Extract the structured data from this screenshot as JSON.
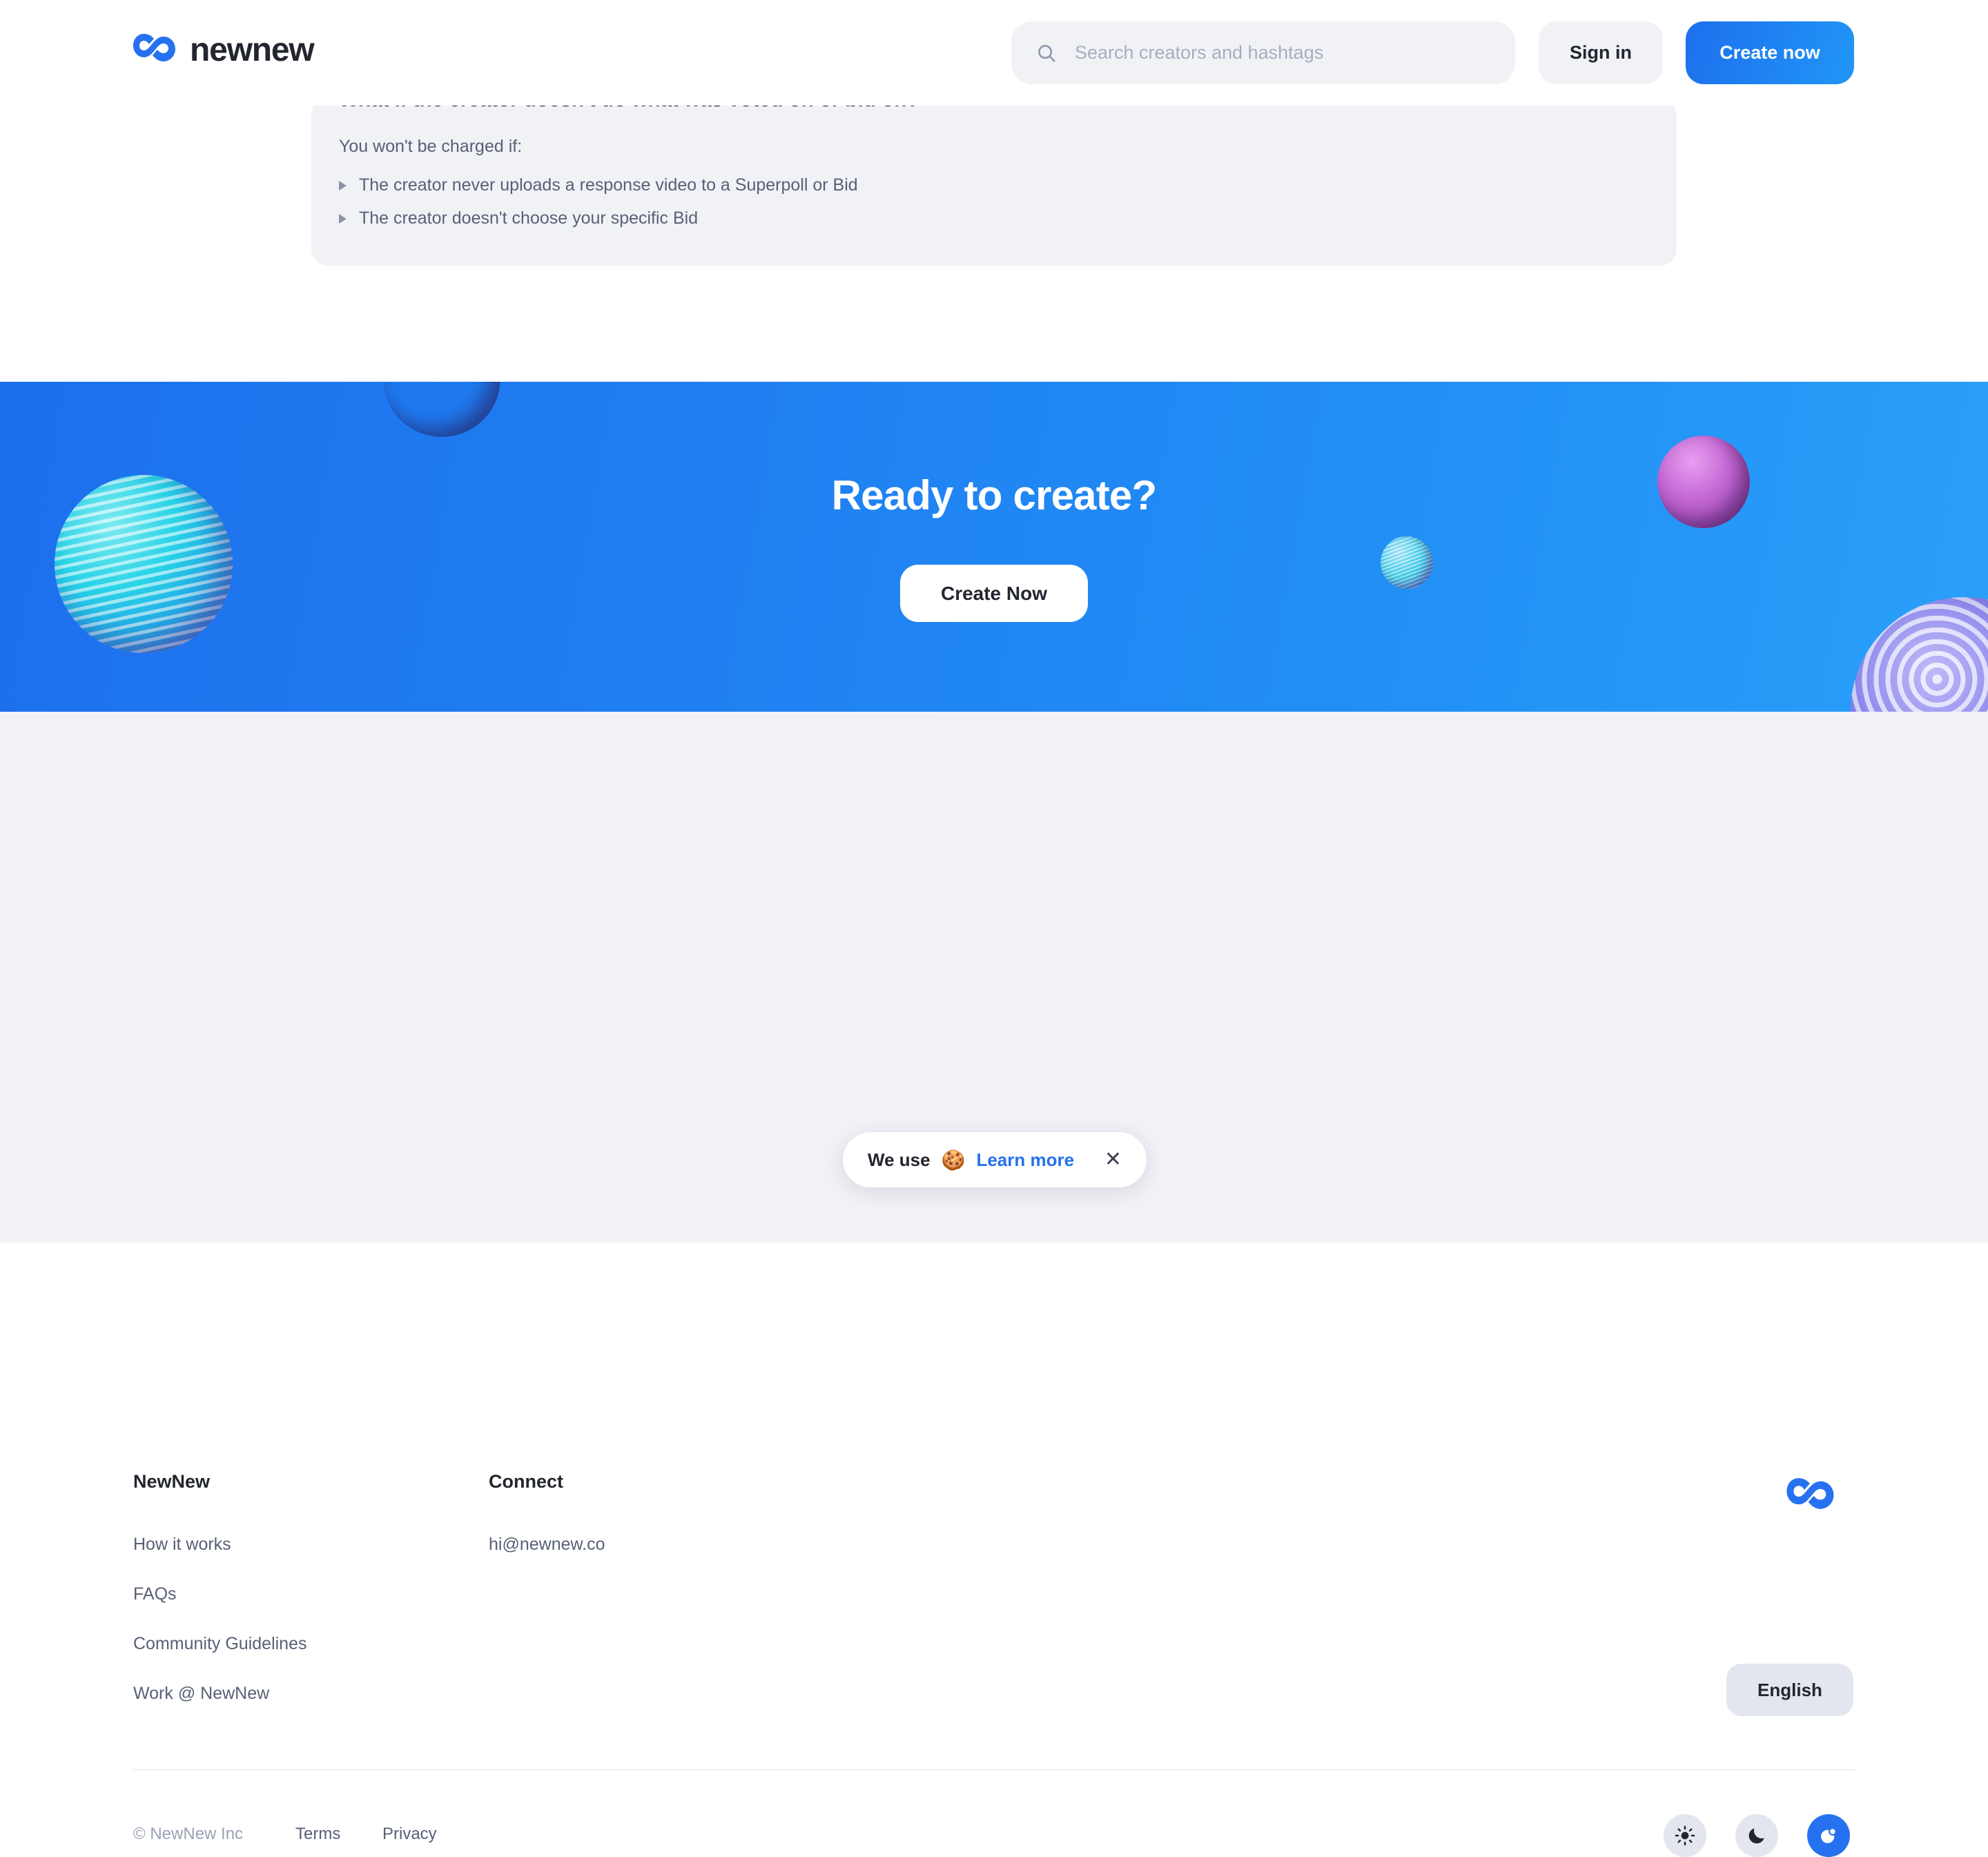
{
  "header": {
    "logo_text": "newnew",
    "logo_icon": "newnew-infinity-logo",
    "search": {
      "icon": "search-icon",
      "placeholder": "Search creators and hashtags",
      "value": ""
    },
    "sign_in_label": "Sign in",
    "create_now_label": "Create now"
  },
  "faq": {
    "question": "What if the creator doesn't do what was voted on or bid on?",
    "intro": "You won't be charged if:",
    "items": [
      "The creator never uploads a response video to a Superpoll or Bid",
      "The creator doesn't choose your specific Bid"
    ]
  },
  "hero": {
    "title": "Ready to create?",
    "cta_label": "Create Now"
  },
  "footer": {
    "columns": [
      {
        "title": "NewNew",
        "links": [
          "How it works",
          "FAQs",
          "Community Guidelines",
          "Work @ NewNew"
        ]
      },
      {
        "title": "Connect",
        "links": [
          "hi@newnew.co"
        ]
      }
    ],
    "logo_icon": "newnew-infinity-logo",
    "language_label": "English",
    "copyright": "© NewNew Inc",
    "terms_label": "Terms",
    "privacy_label": "Privacy",
    "theme_buttons": [
      {
        "name": "light-mode",
        "icon": "sun-icon",
        "active": false
      },
      {
        "name": "dark-mode",
        "icon": "moon-icon",
        "active": false
      },
      {
        "name": "auto-mode",
        "icon": "auto-theme-icon",
        "active": true
      }
    ]
  },
  "cookie_banner": {
    "text": "We use",
    "emoji": "🍪",
    "link_label": "Learn more",
    "close_icon": "close-icon"
  },
  "colors": {
    "brand_blue": "#2671f0",
    "hero_gradient_start": "#1d6fed",
    "hero_gradient_end": "#2aa0fa",
    "surface_gray": "#f1f2f6",
    "text_dark": "#23262f",
    "text_muted": "#586076"
  }
}
